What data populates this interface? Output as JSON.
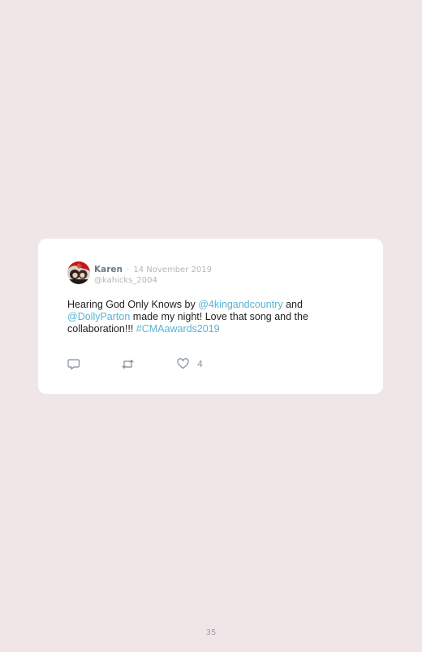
{
  "colors": {
    "page_background": "#f0e6e8",
    "card_background": "#ffffff",
    "link": "#56b4d9",
    "muted": "#b3b7bb",
    "name": "#6b7b8a"
  },
  "tweet": {
    "author_name": "Karen",
    "separator": "·",
    "date": "14 November 2019",
    "handle": "@kahicks_2004",
    "text_segments": [
      {
        "text": "Hearing God Only Knows by ",
        "type": "text"
      },
      {
        "text": "@4kingandcountry",
        "type": "mention"
      },
      {
        "text": " and ",
        "type": "text"
      },
      {
        "text": "@DollyParton",
        "type": "mention"
      },
      {
        "text": " made my night! Love that song and the collaboration!!! ",
        "type": "text"
      },
      {
        "text": "#CMAawards2019",
        "type": "hashtag"
      }
    ],
    "actions": {
      "reply_icon": "reply-icon",
      "retweet_icon": "retweet-icon",
      "like_icon": "heart-icon",
      "like_count": "4"
    }
  },
  "page": {
    "number": "35"
  }
}
